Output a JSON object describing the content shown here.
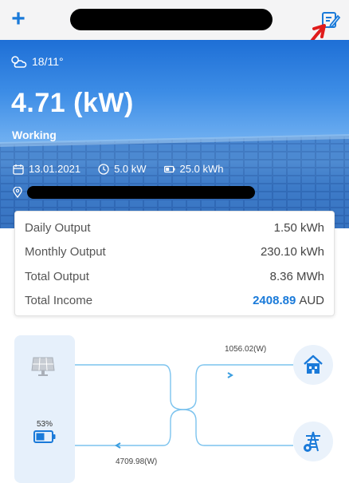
{
  "header": {
    "add_icon": "plus-icon",
    "edit_icon": "edit-note-icon",
    "accent_color": "#1a7ad9"
  },
  "hero": {
    "weather_icon": "partly-cloudy-icon",
    "temperature": "18/11°",
    "power": "4.71 (kW)",
    "status": "Working",
    "date": "13.01.2021",
    "capacity": "5.0 kW",
    "battery_capacity": "25.0 kWh"
  },
  "stats": [
    {
      "label": "Daily Output",
      "value": "1.50 kWh"
    },
    {
      "label": "Monthly Output",
      "value": "230.10 kWh"
    },
    {
      "label": "Total Output",
      "value": "8.36 MWh"
    }
  ],
  "income": {
    "label": "Total Income",
    "amount": "2408.89",
    "currency": "AUD"
  },
  "flow": {
    "battery_percent": "53%",
    "to_home": "1056.02(W)",
    "from_grid": "4709.98(W)",
    "line_color": "#7cc3ee"
  }
}
